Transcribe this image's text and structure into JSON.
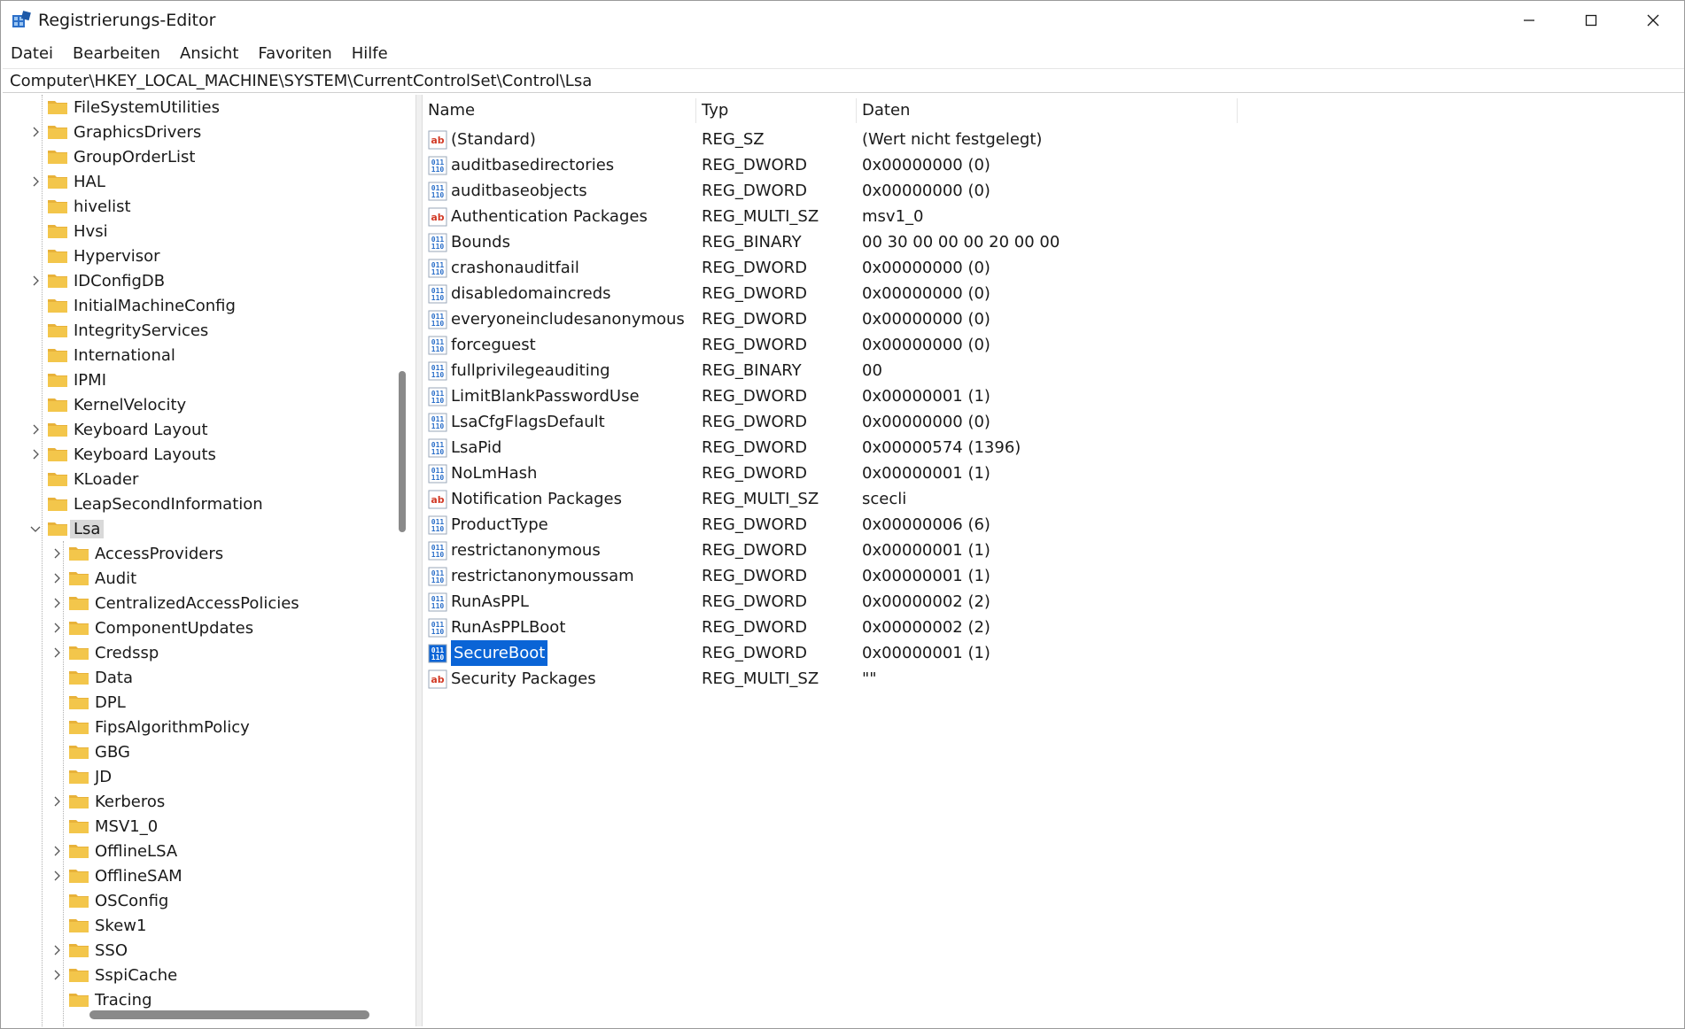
{
  "window": {
    "title": "Registrierungs-Editor"
  },
  "menu": [
    {
      "label": "Datei"
    },
    {
      "label": "Bearbeiten"
    },
    {
      "label": "Ansicht"
    },
    {
      "label": "Favoriten"
    },
    {
      "label": "Hilfe"
    }
  ],
  "address": "Computer\\HKEY_LOCAL_MACHINE\\SYSTEM\\CurrentControlSet\\Control\\Lsa",
  "tree": [
    {
      "label": "FileSystemUtilities",
      "expander": "none",
      "level": 1
    },
    {
      "label": "GraphicsDrivers",
      "expander": "collapsed",
      "level": 1
    },
    {
      "label": "GroupOrderList",
      "expander": "none",
      "level": 1
    },
    {
      "label": "HAL",
      "expander": "collapsed",
      "level": 1
    },
    {
      "label": "hivelist",
      "expander": "none",
      "level": 1
    },
    {
      "label": "Hvsi",
      "expander": "none",
      "level": 1
    },
    {
      "label": "Hypervisor",
      "expander": "none",
      "level": 1
    },
    {
      "label": "IDConfigDB",
      "expander": "collapsed",
      "level": 1
    },
    {
      "label": "InitialMachineConfig",
      "expander": "none",
      "level": 1
    },
    {
      "label": "IntegrityServices",
      "expander": "none",
      "level": 1
    },
    {
      "label": "International",
      "expander": "none",
      "level": 1
    },
    {
      "label": "IPMI",
      "expander": "none",
      "level": 1
    },
    {
      "label": "KernelVelocity",
      "expander": "none",
      "level": 1
    },
    {
      "label": "Keyboard Layout",
      "expander": "collapsed",
      "level": 1
    },
    {
      "label": "Keyboard Layouts",
      "expander": "collapsed",
      "level": 1
    },
    {
      "label": "KLoader",
      "expander": "none",
      "level": 1
    },
    {
      "label": "LeapSecondInformation",
      "expander": "none",
      "level": 1
    },
    {
      "label": "Lsa",
      "expander": "expanded",
      "level": 1,
      "selected": true
    },
    {
      "label": "AccessProviders",
      "expander": "collapsed",
      "level": 2
    },
    {
      "label": "Audit",
      "expander": "collapsed",
      "level": 2
    },
    {
      "label": "CentralizedAccessPolicies",
      "expander": "collapsed",
      "level": 2
    },
    {
      "label": "ComponentUpdates",
      "expander": "collapsed",
      "level": 2
    },
    {
      "label": "Credssp",
      "expander": "collapsed",
      "level": 2
    },
    {
      "label": "Data",
      "expander": "none",
      "level": 2
    },
    {
      "label": "DPL",
      "expander": "none",
      "level": 2
    },
    {
      "label": "FipsAlgorithmPolicy",
      "expander": "none",
      "level": 2
    },
    {
      "label": "GBG",
      "expander": "none",
      "level": 2
    },
    {
      "label": "JD",
      "expander": "none",
      "level": 2
    },
    {
      "label": "Kerberos",
      "expander": "collapsed",
      "level": 2
    },
    {
      "label": "MSV1_0",
      "expander": "none",
      "level": 2
    },
    {
      "label": "OfflineLSA",
      "expander": "collapsed",
      "level": 2
    },
    {
      "label": "OfflineSAM",
      "expander": "collapsed",
      "level": 2
    },
    {
      "label": "OSConfig",
      "expander": "none",
      "level": 2
    },
    {
      "label": "Skew1",
      "expander": "none",
      "level": 2
    },
    {
      "label": "SSO",
      "expander": "collapsed",
      "level": 2
    },
    {
      "label": "SspiCache",
      "expander": "collapsed",
      "level": 2
    },
    {
      "label": "Tracing",
      "expander": "none",
      "level": 2
    }
  ],
  "columns": {
    "name": "Name",
    "type": "Typ",
    "data": "Daten"
  },
  "values": [
    {
      "icon": "string-value-icon",
      "name": "(Standard)",
      "type": "REG_SZ",
      "data": "(Wert nicht festgelegt)"
    },
    {
      "icon": "binary-value-icon",
      "name": "auditbasedirectories",
      "type": "REG_DWORD",
      "data": "0x00000000 (0)"
    },
    {
      "icon": "binary-value-icon",
      "name": "auditbaseobjects",
      "type": "REG_DWORD",
      "data": "0x00000000 (0)"
    },
    {
      "icon": "string-value-icon",
      "name": "Authentication Packages",
      "type": "REG_MULTI_SZ",
      "data": "msv1_0"
    },
    {
      "icon": "binary-value-icon",
      "name": "Bounds",
      "type": "REG_BINARY",
      "data": "00 30 00 00 00 20 00 00"
    },
    {
      "icon": "binary-value-icon",
      "name": "crashonauditfail",
      "type": "REG_DWORD",
      "data": "0x00000000 (0)"
    },
    {
      "icon": "binary-value-icon",
      "name": "disabledomaincreds",
      "type": "REG_DWORD",
      "data": "0x00000000 (0)"
    },
    {
      "icon": "binary-value-icon",
      "name": "everyoneincludesanonymous",
      "type": "REG_DWORD",
      "data": "0x00000000 (0)"
    },
    {
      "icon": "binary-value-icon",
      "name": "forceguest",
      "type": "REG_DWORD",
      "data": "0x00000000 (0)"
    },
    {
      "icon": "binary-value-icon",
      "name": "fullprivilegeauditing",
      "type": "REG_BINARY",
      "data": "00"
    },
    {
      "icon": "binary-value-icon",
      "name": "LimitBlankPasswordUse",
      "type": "REG_DWORD",
      "data": "0x00000001 (1)"
    },
    {
      "icon": "binary-value-icon",
      "name": "LsaCfgFlagsDefault",
      "type": "REG_DWORD",
      "data": "0x00000000 (0)"
    },
    {
      "icon": "binary-value-icon",
      "name": "LsaPid",
      "type": "REG_DWORD",
      "data": "0x00000574 (1396)"
    },
    {
      "icon": "binary-value-icon",
      "name": "NoLmHash",
      "type": "REG_DWORD",
      "data": "0x00000001 (1)"
    },
    {
      "icon": "string-value-icon",
      "name": "Notification Packages",
      "type": "REG_MULTI_SZ",
      "data": "scecli"
    },
    {
      "icon": "binary-value-icon",
      "name": "ProductType",
      "type": "REG_DWORD",
      "data": "0x00000006 (6)"
    },
    {
      "icon": "binary-value-icon",
      "name": "restrictanonymous",
      "type": "REG_DWORD",
      "data": "0x00000001 (1)"
    },
    {
      "icon": "binary-value-icon",
      "name": "restrictanonymoussam",
      "type": "REG_DWORD",
      "data": "0x00000001 (1)"
    },
    {
      "icon": "binary-value-icon",
      "name": "RunAsPPL",
      "type": "REG_DWORD",
      "data": "0x00000002 (2)"
    },
    {
      "icon": "binary-value-icon",
      "name": "RunAsPPLBoot",
      "type": "REG_DWORD",
      "data": "0x00000002 (2)"
    },
    {
      "icon": "binary-value-icon",
      "name": "SecureBoot",
      "type": "REG_DWORD",
      "data": "0x00000001 (1)",
      "selected": true
    },
    {
      "icon": "string-value-icon",
      "name": "Security Packages",
      "type": "REG_MULTI_SZ",
      "data": "\"\""
    }
  ],
  "colors": {
    "selection_blue": "#0a64d6",
    "tree_selection": "#d9d9d9",
    "folder_yellow": "#f3c64b",
    "string_icon_red": "#d23c28",
    "binary_icon_blue": "#2b6fc9"
  }
}
